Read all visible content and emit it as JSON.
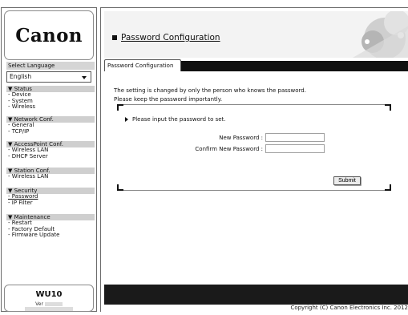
{
  "sidebar": {
    "logo": "Canon",
    "select_language_label": "Select Language",
    "language_value": "English",
    "sections": [
      {
        "title": "▼ Status",
        "items": [
          "- Device",
          "- System",
          "- Wireless"
        ]
      },
      {
        "title": "▼ Network Conf.",
        "items": [
          "- General",
          "- TCP/IP"
        ]
      },
      {
        "title": "▼ AccessPoint Conf.",
        "items": [
          "- Wireless LAN",
          "- DHCP Server"
        ]
      },
      {
        "title": "▼ Station Conf.",
        "items": [
          "- Wireless LAN"
        ]
      },
      {
        "title": "▼ Security",
        "items": [
          "- Password",
          "- IP Filter"
        ]
      },
      {
        "title": "▼ Maintenance",
        "items": [
          "- Restart",
          "- Factory Default",
          "- Firmware Update"
        ]
      }
    ],
    "model": "WU10",
    "version_label": "Ver",
    "version_value": "",
    "version_build": ""
  },
  "main": {
    "title": "Password Configuration",
    "tab_label": "Password Configuration",
    "note_line1": "The setting is changed by only the person who knows the password.",
    "note_line2": "Please keep the password importantly.",
    "prompt": "Please input the password to set.",
    "new_password_label": "New Password :",
    "confirm_password_label": "Confirm New Password :",
    "new_password_value": "",
    "confirm_password_value": "",
    "submit_label": "Submit"
  },
  "footer": {
    "copyright": "Copyright (C) Canon Electronics Inc. 2012"
  },
  "colors": {
    "dark_bar": "#111111",
    "panel_border": "#6c6c6c",
    "nav_header_bg": "#cfcfcf"
  }
}
